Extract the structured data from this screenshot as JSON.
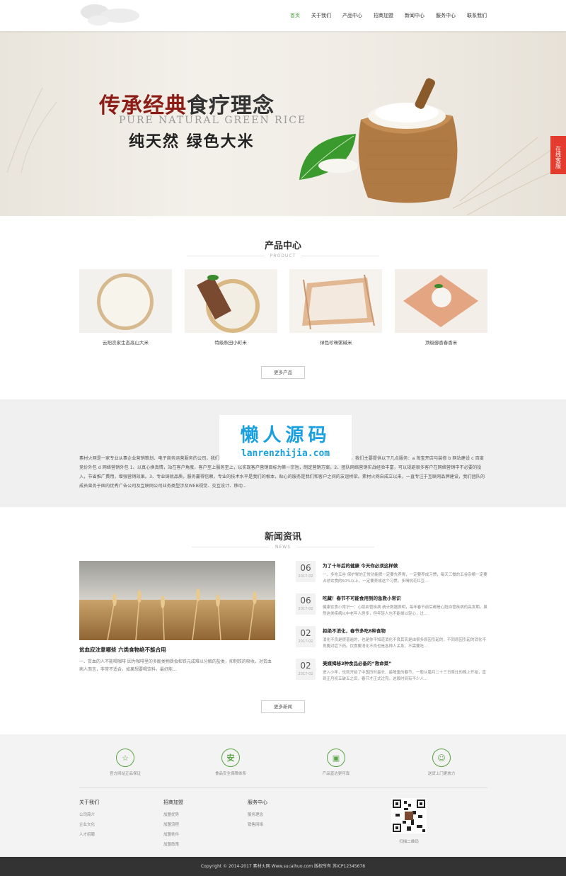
{
  "nav": {
    "items": [
      "首页",
      "关于我们",
      "产品中心",
      "招商加盟",
      "新闻中心",
      "服务中心",
      "联系我们"
    ],
    "active": "首页"
  },
  "banner": {
    "slogan_part1": "传承经典",
    "slogan_part2": "食疗理念",
    "subtitle_en": "PURE NATURAL GREEN RICE",
    "subtitle_cn": "纯天然  绿色大米",
    "slide_count": 2,
    "active_slide": 1
  },
  "side_service": "在线客服",
  "products": {
    "heading": "产品中心",
    "heading_en": "PRODUCT",
    "items": [
      {
        "name": "云阳农家生态高山大米"
      },
      {
        "name": "特级秋田小町米"
      },
      {
        "name": "绿色珍珠粥碱米"
      },
      {
        "name": "顶级御香春香米"
      }
    ],
    "more": "更多产品"
  },
  "about": {
    "text": "素材火网是一家专业从事企业营销策划、电子商务运营服务的公司，我们秉承“专注、专业、诚信”的企业精神，为客户提供全方位的营销服务。我们主要提供以下几点服务：a 淘宝开店与装修 b 网站建设 c 百度竞价外包 d 网络营销外包 1、以真心换真情，站在客户角度，客户至上服务至上，以实现客户营销目标为第一宗旨，制定营销方案。2、团队网络营销实战经验丰富，可以规避很多客户在网络营销中不必要的投入，节省推广费用，增强营销效果。3、专业铸就品质，服务赢得信赖，专业的技术水平是我们的根本，贴心的服务是我们和客户之间的友谊桥梁。素材火网自成立以来，一直专注于互联网品牌建设，我们团队的成员曾务于国内优秀广告公司及互联网公司业务类型涉及WEB视觉、交互设计、移动...",
    "watermark_cn": "懒人源码",
    "watermark_en": "lanrenzhijia.com"
  },
  "news": {
    "heading": "新闻资讯",
    "heading_en": "NEWS",
    "featured": {
      "title": "贫血应注意哪些 六类食物绝不能合用",
      "desc": "一、贫血的人不能喝咖啡 因为咖啡里的多酚类物质会和铁元成难以分解的盐类，抑制铁的吸收。对贫血病人而言，非常不适合。如果想要喝饮料，最好能..."
    },
    "items": [
      {
        "day": "06",
        "month": "2017-02",
        "title": "为了十年后的健康 今天你必须这样做",
        "desc": "一、多吃五谷 保护胃的正常功能牌一定要先养胃，一定要养成习惯，每天三餐的五谷杂粮一定要占总饮食的50%以上，一定要养成这个习惯。多喝桃花红豆..."
      },
      {
        "day": "06",
        "month": "2017-02",
        "title": "吃藏！春节不可能食用到的急救小常识",
        "desc": "健康饮食小常识一：心肌血管疾病 统计数据表明，每年春节前后都是心脏血管疾病的高发期。虽然这类疾病以中老年人居多，但年轻人也不能掉以轻心，过..."
      },
      {
        "day": "02",
        "month": "2017-02",
        "title": "拒绝不消化，春节多吃8种食物",
        "desc": "消化不良是很普遍的，也是你不知道消化不良其实是由很多原因引起的，不同原因引起的消化不良要对症下药。饮食要消化不良也是各种人关系，不需要吃..."
      },
      {
        "day": "02",
        "month": "2017-02",
        "title": "美媒揭秘3种食品必备的“救命菜”",
        "desc": "进入小年，也就开始了中国历时最长、最隆重的春节，一般从腊月二十三日祭灶的晚上开始，直到正月初五破五之后，春节才正式过完。这段时间有不少人..."
      }
    ],
    "more": "更多新闻"
  },
  "features": [
    {
      "icon": "star-badge-icon",
      "label": "官方网站正品保证"
    },
    {
      "icon": "safety-icon",
      "label": "食品安全保障体系"
    },
    {
      "icon": "truck-icon",
      "label": "产品直达更可靠"
    },
    {
      "icon": "service-person-icon",
      "label": "送货上门更放力"
    }
  ],
  "footer": {
    "columns": [
      {
        "title": "关于我们",
        "links": [
          "公司简介",
          "企业文化",
          "人才招聘"
        ]
      },
      {
        "title": "招商加盟",
        "links": [
          "加盟优势",
          "加盟流程",
          "加盟条件",
          "加盟政策"
        ]
      },
      {
        "title": "服务中心",
        "links": [
          "服务理念",
          "销售网络"
        ]
      }
    ],
    "qr_caption": "扫描二维码",
    "copyright": "Copyright © 2014-2017 素材火网 Www.sucaihuo.com 版权所有    苏ICP12345678"
  },
  "colors": {
    "accent_green": "#4aa33b",
    "banner_red": "#8c1d16",
    "service_red": "#e33b2e",
    "watermark_blue": "#1aa0e0"
  }
}
